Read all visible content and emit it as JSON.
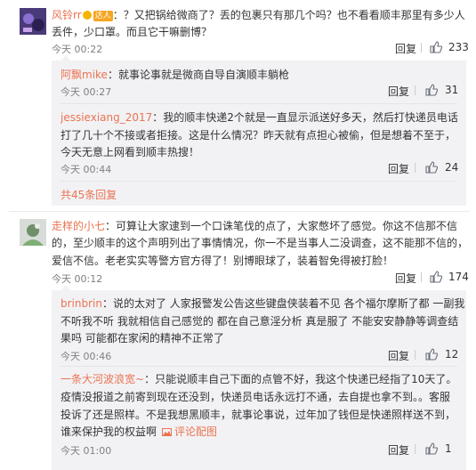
{
  "ui": {
    "reply_label": "回复",
    "link_color": "#eb7350",
    "reply_bg": "#f2f2f5"
  },
  "comments": [
    {
      "user": "风铃rr",
      "badge": "达人",
      "lines": [
        "：？又把锅给微商了？丢的包裹只有那几个吗？也不看看顺丰那里有多少人",
        "丢件，少口罩。而且它干嘛删博？"
      ],
      "time": "今天 00:22",
      "likes": "233",
      "replies": [
        {
          "user": "阿飘mike",
          "lines": [
            "：就事论事就是微商自导自演顺丰躺枪"
          ],
          "time": "今天 00:27",
          "likes": "31"
        },
        {
          "user": "jessiexiang_2017",
          "lines": [
            "：我的顺丰快递2个就是一直显示派送好多天，然后打快递员电话",
            "打了几十个不接或者拒接。这是什么情况？昨天就有点担心被偷，但是想着不至于，",
            "今天无意上网看到顺丰热搜！"
          ],
          "time": "今天 00:44",
          "likes": "24"
        }
      ],
      "more": "共45条回复"
    },
    {
      "user": "走样的小七",
      "lines": [
        "：可算让大家逮到一个口诛笔伐的点了，大家憋坏了感觉。你这不信那不信",
        "的，至少顺丰的这个声明列出了事情情况，你一不是当事人二没调查，这不能那不信的，",
        "爱信不信。老老实实等警方官方得了！别博眼球了，装着智免得被打脸！"
      ],
      "time": "今天 00:12",
      "likes": "174",
      "replies": [
        {
          "user": "brinbrin",
          "lines": [
            "：说的太对了 人家报警发公告这些键盘侠装着不见 各个福尔摩斯了都 一副我",
            "不听我不听 我就相信自己感觉的 都在自己意淫分析 真是服了 不能安安静静等调查结",
            "果吗  可能都在家闲的精神不正常了"
          ],
          "time": "今天 00:46",
          "likes": "12"
        },
        {
          "user": "一条大河波浪宽~",
          "lines": [
            "：只能说顺丰自己下面的点管不好，我这个快递已经指了10天了。",
            "疫情没报道之前寄到现在还没到，快递员电话永远打不通，去自提也拿不到。。客服",
            "投诉了还是照样。不是我想黑顺丰，就事论事说，过年加了钱但是快递照样送不到，",
            "谁来保护我的权益啊"
          ],
          "pic_label": "评论配图",
          "time": "今天 01:00",
          "likes": "1"
        }
      ]
    }
  ]
}
